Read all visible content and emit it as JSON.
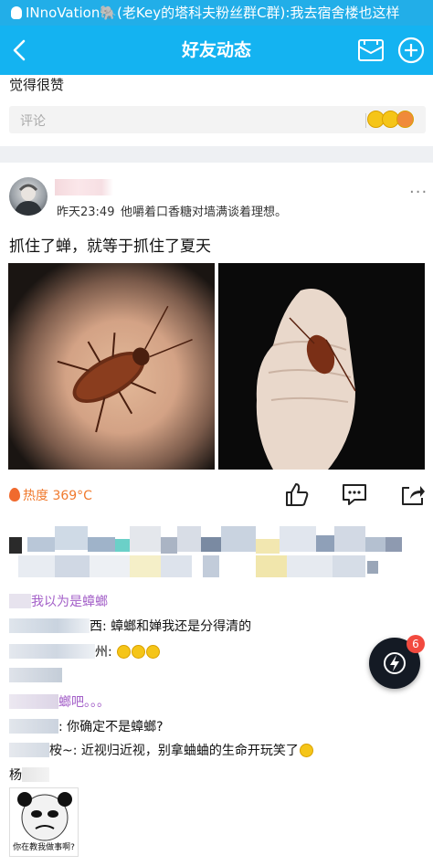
{
  "status_bar": {
    "notification_text": "INnoVation🐘(老Key的塔科夫粉丝群C群):我去宿舍楼也这样"
  },
  "nav": {
    "title": "好友动态"
  },
  "previous_post": {
    "partial_text": "觉得很赞",
    "comment_placeholder": "评论"
  },
  "post": {
    "time": "昨天23:49",
    "status": "他嚼着口香糖对墙满谈着理想。",
    "text": "抓住了蝉，就等于抓住了夏天",
    "heat": "热度 369°C"
  },
  "comments": [
    {
      "author_visible": "",
      "text": "我以为是蟑螂",
      "style": "purple"
    },
    {
      "author_visible": "西",
      "text": ": 蟑螂和婵我还是分得清的",
      "style": "normal"
    },
    {
      "author_visible": "州",
      "text": ": ",
      "emojis": 3,
      "style": "normal"
    },
    {
      "author_visible": "",
      "text": "",
      "style": "normal"
    },
    {
      "author_visible": "",
      "text": "螂吧。。。",
      "style": "purple"
    },
    {
      "author_visible": "",
      "text": ": 你确定不是蟑螂?",
      "style": "normal"
    },
    {
      "author_visible": "桉",
      "text": "~: 近视归近视，别拿蛐蛐的生命开玩笑了",
      "emojis": 1,
      "style": "normal"
    },
    {
      "author_visible": "杨",
      "text": "",
      "style": "normal"
    }
  ],
  "sticker": {
    "caption": "你在教我做事啊?"
  },
  "fab": {
    "badge_count": "6"
  },
  "colors": {
    "nav_blue": "#14b3f1",
    "status_blue": "#22aee8",
    "heat_orange": "#f07a2e",
    "badge_red": "#f24a3f"
  }
}
